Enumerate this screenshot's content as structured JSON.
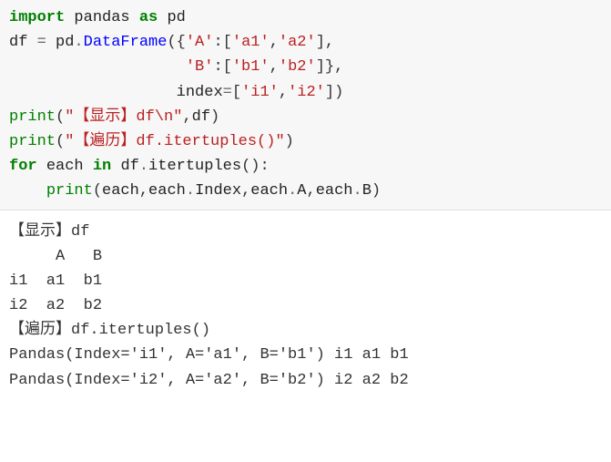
{
  "code": {
    "t_import": "import",
    "t_pandas": "pandas",
    "t_as": "as",
    "t_pd": "pd",
    "t_df": "df",
    "t_eq": "=",
    "t_pd2": "pd",
    "t_dot1": ".",
    "t_DataFrame": "DataFrame",
    "t_lp1": "(",
    "t_lb1": "{",
    "t_sA": "'A'",
    "t_col1": ":",
    "t_lbr1": "[",
    "t_sa1": "'a1'",
    "t_com1": ",",
    "t_sa2": "'a2'",
    "t_rbr1": "]",
    "t_com2": ",",
    "t_sB": "'B'",
    "t_col2": ":",
    "t_lbr2": "[",
    "t_sb1": "'b1'",
    "t_com3": ",",
    "t_sb2": "'b2'",
    "t_rbr2": "]",
    "t_rb1": "}",
    "t_com4": ",",
    "t_index": "index",
    "t_eq2": "=",
    "t_lbr3": "[",
    "t_si1": "'i1'",
    "t_com5": ",",
    "t_si2": "'i2'",
    "t_rbr3": "]",
    "t_rp1": ")",
    "t_print1": "print",
    "t_lp2": "(",
    "t_str1": "\"【显示】df\\n\"",
    "t_com6": ",",
    "t_df2": "df",
    "t_rp2": ")",
    "t_print2": "print",
    "t_lp3": "(",
    "t_str2": "\"【遍历】df.itertuples()\"",
    "t_rp3": ")",
    "t_for": "for",
    "t_each": "each",
    "t_in": "in",
    "t_df3": "df",
    "t_dot2": ".",
    "t_itertuples": "itertuples",
    "t_lp4": "(",
    "t_rp4": ")",
    "t_col3": ":",
    "t_print3": "print",
    "t_lp5": "(",
    "t_each2": "each",
    "t_com7": ",",
    "t_each3": "each",
    "t_dot3": ".",
    "t_Index": "Index",
    "t_com8": ",",
    "t_each4": "each",
    "t_dot4": ".",
    "t_A": "A",
    "t_com9": ",",
    "t_each5": "each",
    "t_dot5": ".",
    "t_B": "B",
    "t_rp5": ")"
  },
  "output": {
    "l1": "【显示】df",
    "l2": "     A   B",
    "l3": "i1  a1  b1",
    "l4": "i2  a2  b2",
    "l5": "【遍历】df.itertuples()",
    "l6": "Pandas(Index='i1', A='a1', B='b1') i1 a1 b1",
    "l7": "Pandas(Index='i2', A='a2', B='b2') i2 a2 b2"
  }
}
